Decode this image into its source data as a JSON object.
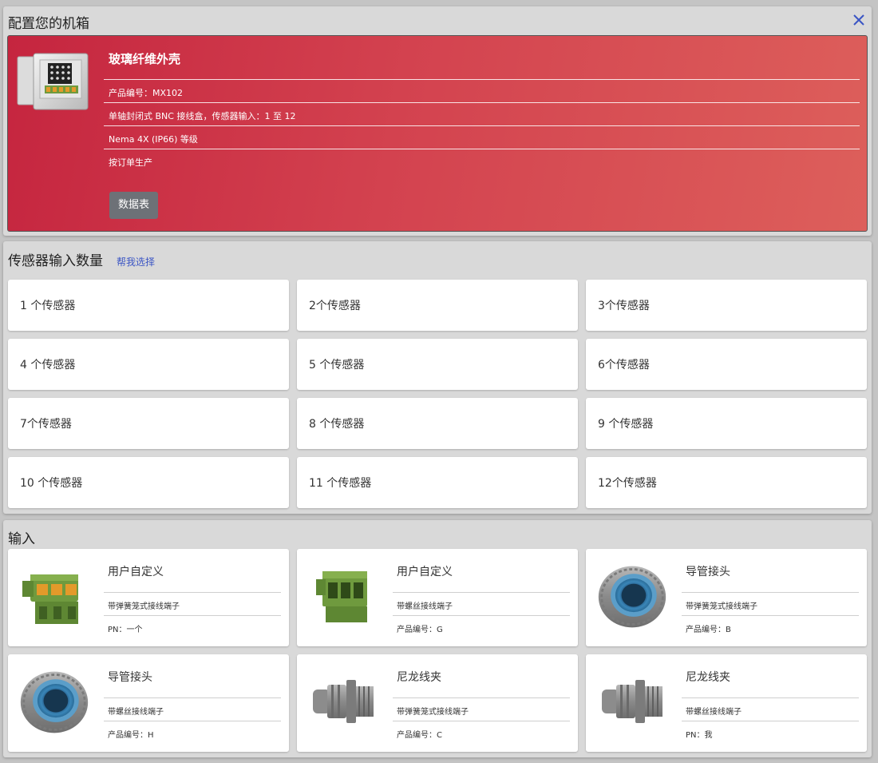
{
  "enclosure": {
    "panel_title": "配置您的机箱",
    "close_icon": "close-icon",
    "card": {
      "title": "玻璃纤维外壳",
      "details": [
        "产品编号：MX102",
        "单轴封闭式 BNC 接线盒，传感器输入：1 至 12",
        "Nema 4X (IP66) 等级",
        "按订单生产"
      ],
      "button_label": "数据表"
    },
    "colors": {
      "card_gradient_start": "#c5253f",
      "card_gradient_end": "#dd5f5b",
      "button": "#6d7177",
      "close_icon": "#3b55c4"
    }
  },
  "sensors": {
    "panel_title": "传感器输入数量",
    "help_link": "帮我选择",
    "options": [
      "1 个传感器",
      "2个传感器",
      "3个传感器",
      "4 个传感器",
      "5 个传感器",
      "6个传感器",
      "7个传感器",
      "8 个传感器",
      "9 个传感器",
      "10 个传感器",
      "11 个传感器",
      "12个传感器"
    ]
  },
  "inputs": {
    "panel_title": "输入",
    "items": [
      {
        "title": "用户自定义",
        "line1": "带弹簧笼式接线端子",
        "line2": "PN：一个",
        "icon": "spring-terminal-block-icon"
      },
      {
        "title": "用户自定义",
        "line1": "带螺丝接线端子",
        "line2": "产品编号：G",
        "icon": "screw-terminal-block-icon"
      },
      {
        "title": "导管接头",
        "line1": "带弹簧笼式接线端子",
        "line2": "产品编号：B",
        "icon": "conduit-fitting-icon"
      },
      {
        "title": "导管接头",
        "line1": "带螺丝接线端子",
        "line2": "产品编号：H",
        "icon": "conduit-fitting-icon"
      },
      {
        "title": "尼龙线夹",
        "line1": "带弹簧笼式接线端子",
        "line2": "产品编号：C",
        "icon": "nylon-cable-gland-icon"
      },
      {
        "title": "尼龙线夹",
        "line1": "带螺丝接线端子",
        "line2": "PN：我",
        "icon": "nylon-cable-gland-icon"
      }
    ]
  }
}
